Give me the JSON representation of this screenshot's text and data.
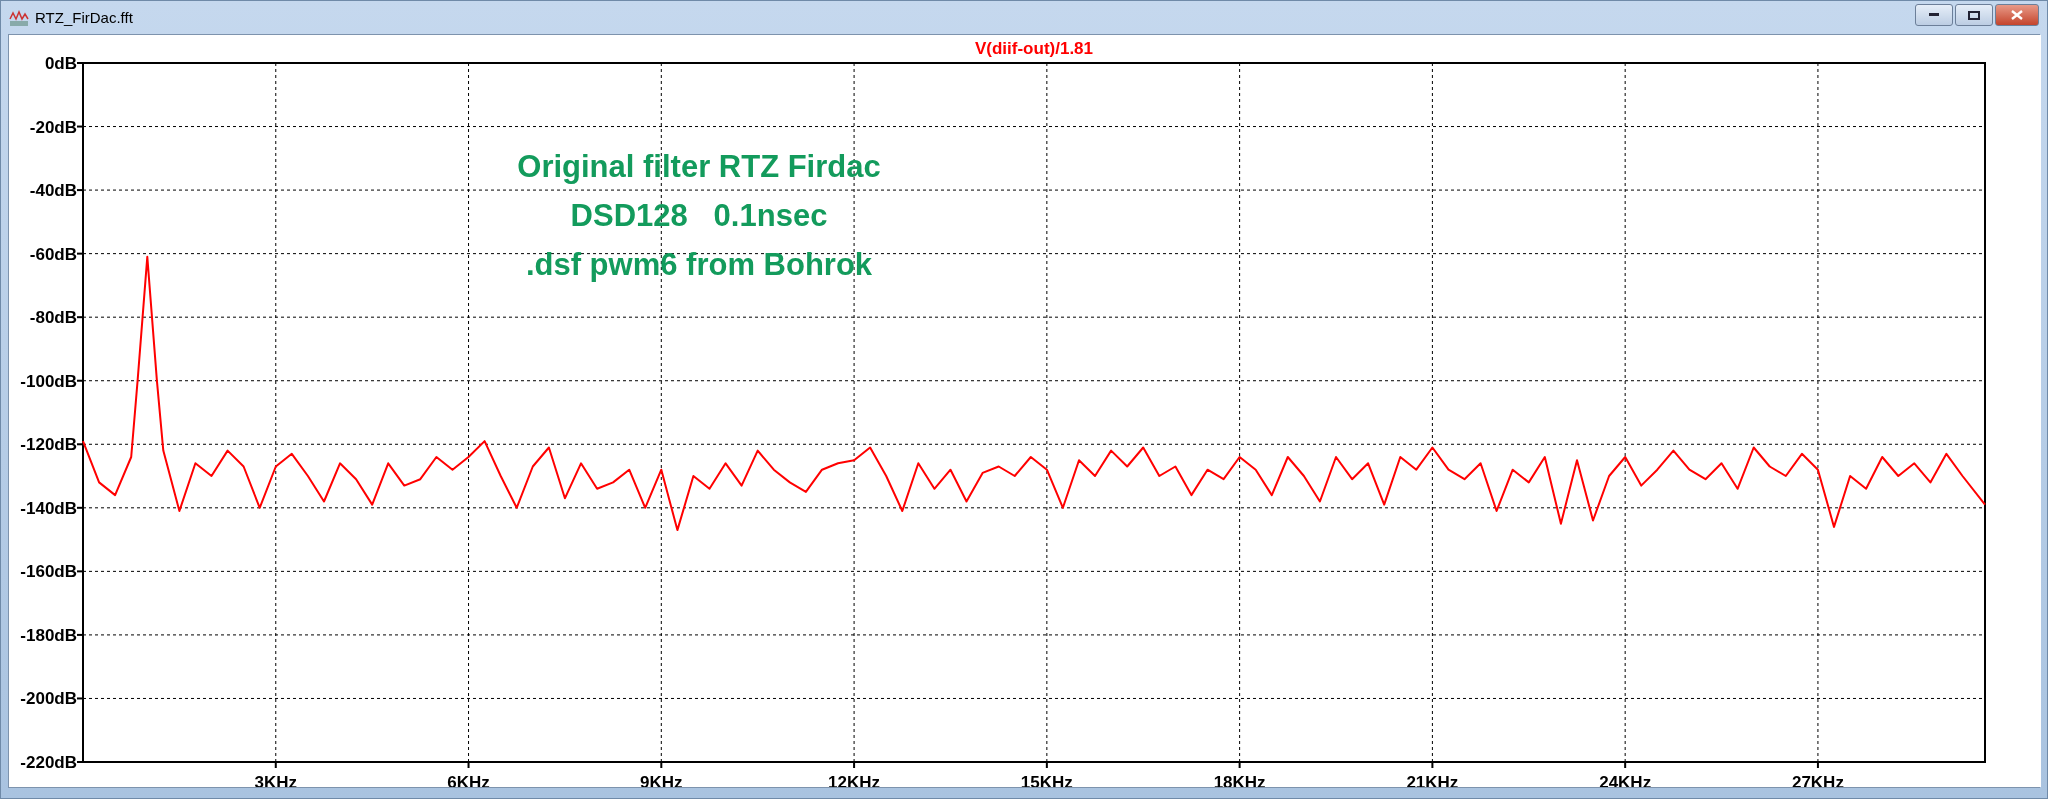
{
  "window": {
    "title": "RTZ_FirDac.fft"
  },
  "plot": {
    "chart_data": {
      "type": "line",
      "grid": true,
      "xlim": [
        0,
        29.6
      ],
      "ylim": [
        -220,
        0
      ],
      "xticks": [
        {
          "value": 3,
          "label": "3KHz"
        },
        {
          "value": 6,
          "label": "6KHz"
        },
        {
          "value": 9,
          "label": "9KHz"
        },
        {
          "value": 12,
          "label": "12KHz"
        },
        {
          "value": 15,
          "label": "15KHz"
        },
        {
          "value": 18,
          "label": "18KHz"
        },
        {
          "value": 21,
          "label": "21KHz"
        },
        {
          "value": 24,
          "label": "24KHz"
        },
        {
          "value": 27,
          "label": "27KHz"
        }
      ],
      "yticks": [
        {
          "value": 0,
          "label": "0dB"
        },
        {
          "value": -20,
          "label": "-20dB"
        },
        {
          "value": -40,
          "label": "-40dB"
        },
        {
          "value": -60,
          "label": "-60dB"
        },
        {
          "value": -80,
          "label": "-80dB"
        },
        {
          "value": -100,
          "label": "-100dB"
        },
        {
          "value": -120,
          "label": "-120dB"
        },
        {
          "value": -140,
          "label": "-140dB"
        },
        {
          "value": -160,
          "label": "-160dB"
        },
        {
          "value": -180,
          "label": "-180dB"
        },
        {
          "value": -200,
          "label": "-200dB"
        },
        {
          "value": -220,
          "label": "-220dB"
        }
      ],
      "x": [
        0,
        0.25,
        0.5,
        0.75,
        0.85,
        1.0,
        1.15,
        1.25,
        1.5,
        1.75,
        2.0,
        2.25,
        2.5,
        2.75,
        3.0,
        3.25,
        3.5,
        3.75,
        4.0,
        4.25,
        4.5,
        4.75,
        5.0,
        5.25,
        5.5,
        5.75,
        6.0,
        6.25,
        6.5,
        6.75,
        7.0,
        7.25,
        7.5,
        7.75,
        8.0,
        8.25,
        8.5,
        8.75,
        9.0,
        9.25,
        9.5,
        9.75,
        10.0,
        10.25,
        10.5,
        10.75,
        11.0,
        11.25,
        11.5,
        11.75,
        12.0,
        12.25,
        12.5,
        12.75,
        13.0,
        13.25,
        13.5,
        13.75,
        14.0,
        14.25,
        14.5,
        14.75,
        15.0,
        15.25,
        15.5,
        15.75,
        16.0,
        16.25,
        16.5,
        16.75,
        17.0,
        17.25,
        17.5,
        17.75,
        18.0,
        18.25,
        18.5,
        18.75,
        19.0,
        19.25,
        19.5,
        19.75,
        20.0,
        20.25,
        20.5,
        20.75,
        21.0,
        21.25,
        21.5,
        21.75,
        22.0,
        22.25,
        22.5,
        22.75,
        23.0,
        23.25,
        23.5,
        23.75,
        24.0,
        24.25,
        24.5,
        24.75,
        25.0,
        25.25,
        25.5,
        25.75,
        26.0,
        26.25,
        26.5,
        26.75,
        27.0,
        27.25,
        27.5,
        27.75,
        28.0,
        28.25,
        28.5,
        28.75,
        29.0,
        29.25,
        29.6
      ],
      "series": [
        {
          "name": "V(diif-out)/1.81",
          "color": "#ff0000",
          "values": [
            -119,
            -132,
            -136,
            -124,
            -100,
            -61,
            -100,
            -122,
            -141,
            -126,
            -130,
            -122,
            -127,
            -140,
            -127,
            -123,
            -130,
            -138,
            -126,
            -131,
            -139,
            -126,
            -133,
            -131,
            -124,
            -128,
            -124,
            -119,
            -130,
            -140,
            -127,
            -121,
            -137,
            -126,
            -134,
            -132,
            -128,
            -140,
            -128,
            -147,
            -130,
            -134,
            -126,
            -133,
            -122,
            -128,
            -132,
            -135,
            -128,
            -126,
            -125,
            -121,
            -130,
            -141,
            -126,
            -134,
            -128,
            -138,
            -129,
            -127,
            -130,
            -124,
            -128,
            -140,
            -125,
            -130,
            -122,
            -127,
            -121,
            -130,
            -127,
            -136,
            -128,
            -131,
            -124,
            -128,
            -136,
            -124,
            -130,
            -138,
            -124,
            -131,
            -126,
            -139,
            -124,
            -128,
            -121,
            -128,
            -131,
            -126,
            -141,
            -128,
            -132,
            -124,
            -145,
            -125,
            -144,
            -130,
            -124,
            -133,
            -128,
            -122,
            -128,
            -131,
            -126,
            -134,
            -121,
            -127,
            -130,
            -123,
            -128,
            -146,
            -130,
            -134,
            -124,
            -130,
            -126,
            -132,
            -123,
            -130,
            -139
          ]
        }
      ],
      "annotations": [
        "Original filter RTZ Firdac",
        "DSD128   0.1nsec",
        ".dsf pwm6 from Bohrok"
      ]
    }
  }
}
